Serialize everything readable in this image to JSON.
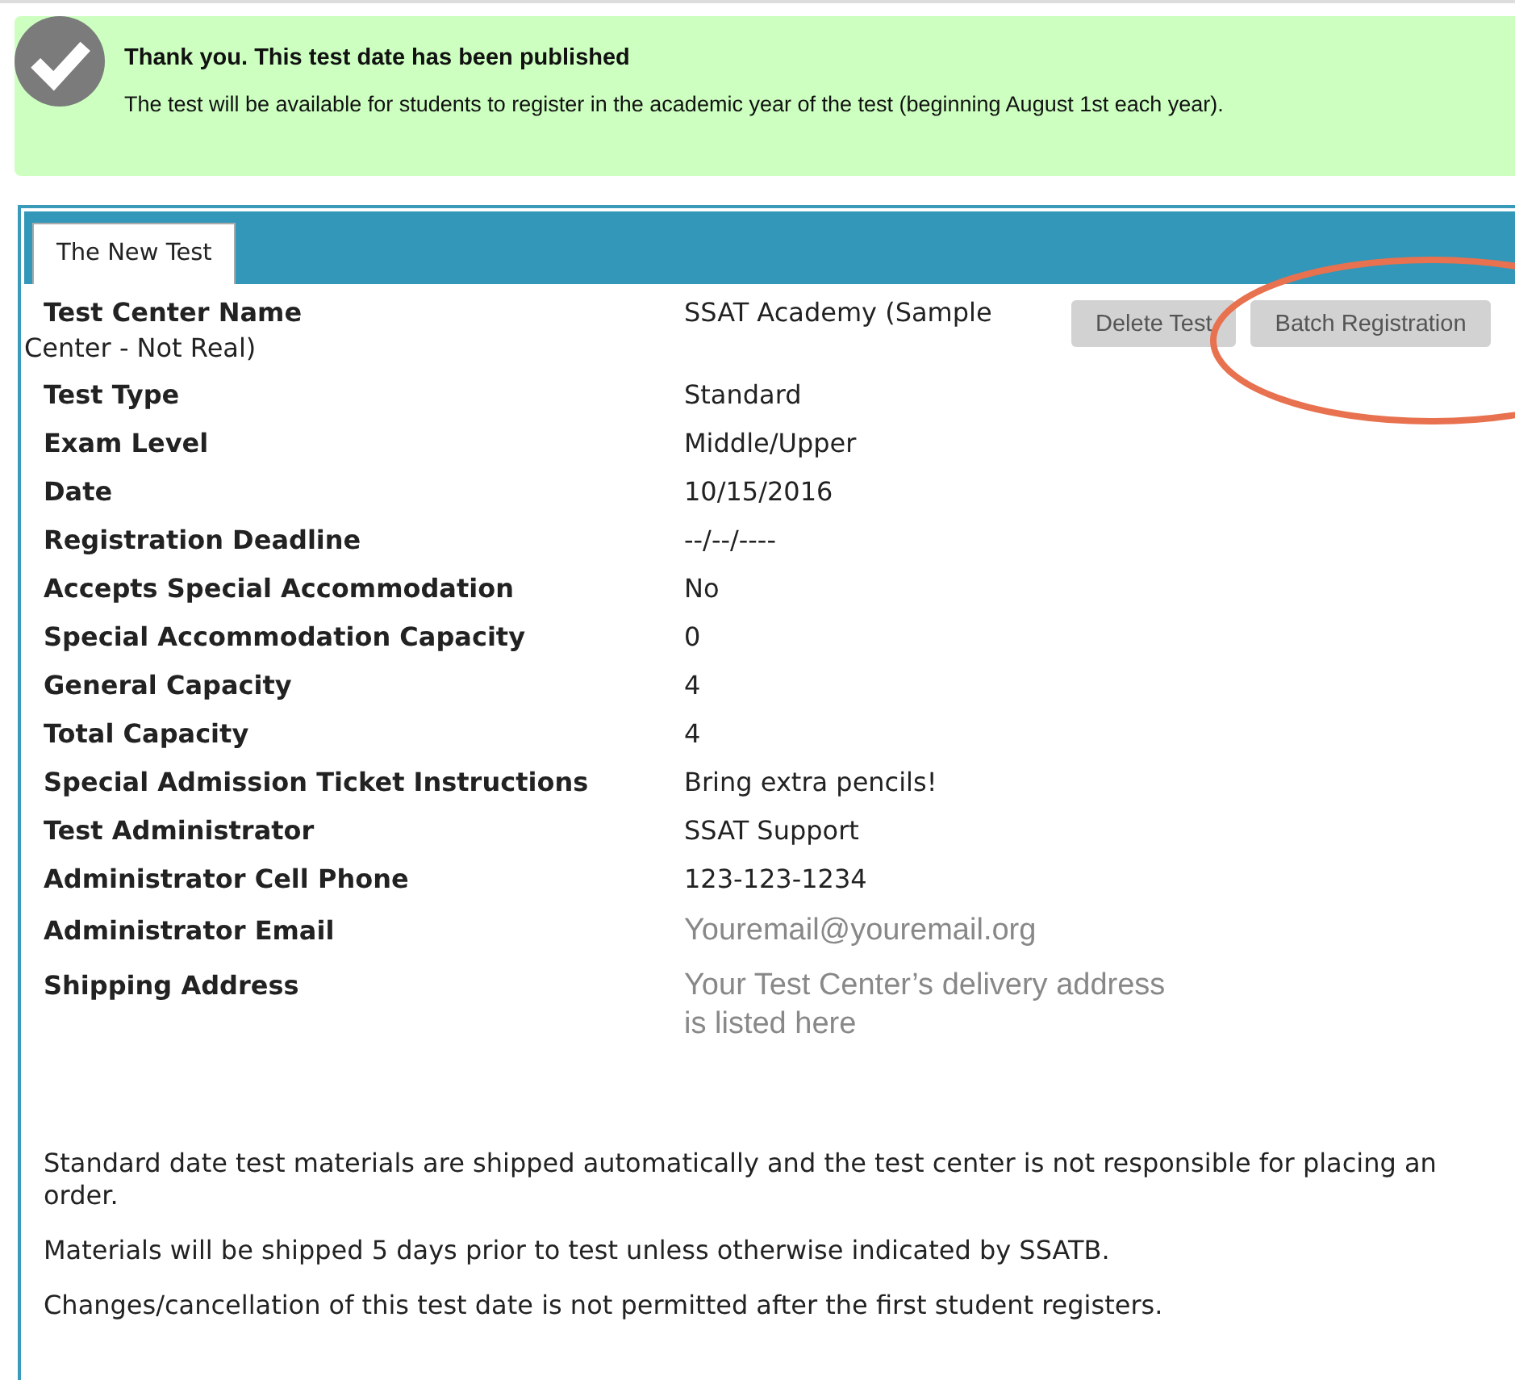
{
  "banner": {
    "title": "Thank you. This test date has been published",
    "message": "The test will be available for students to register in the academic year of the test (beginning August 1st each year)."
  },
  "tabs": [
    {
      "label": "The New Test",
      "selected": true
    }
  ],
  "buttons": [
    "Delete Test",
    "Batch Registration"
  ],
  "header_field": {
    "label": "Test Center Name",
    "value": "SSAT Academy (Sample",
    "value_overflow": "Center - Not Real)"
  },
  "fields": [
    {
      "label": "Test Type",
      "value": "Standard",
      "kind": "plain"
    },
    {
      "label": "Exam Level",
      "value": "Middle/Upper",
      "kind": "plain"
    },
    {
      "label": "Date",
      "value": "10/15/2016",
      "kind": "plain"
    },
    {
      "label": "Registration Deadline",
      "value": "--/--/----",
      "kind": "plain"
    },
    {
      "label": "Accepts Special Accommodation",
      "value": "No",
      "kind": "plain"
    },
    {
      "label": "Special Accommodation Capacity",
      "value": "0",
      "kind": "plain"
    },
    {
      "label": "General Capacity",
      "value": "4",
      "kind": "plain"
    },
    {
      "label": "Total Capacity",
      "value": "4",
      "kind": "plain"
    },
    {
      "label": "Special Admission Ticket Instructions",
      "value": "Bring extra pencils!",
      "kind": "plain"
    },
    {
      "label": "Test Administrator",
      "value": "SSAT Support",
      "kind": "plain"
    },
    {
      "label": "Administrator Cell Phone",
      "value": "123-123-1234",
      "kind": "plain"
    },
    {
      "label": "Administrator Email",
      "value": "Youremail@youremail.org",
      "kind": "note"
    },
    {
      "label": "Shipping Address",
      "value": "Your Test Center’s delivery address is listed here",
      "kind": "note"
    }
  ],
  "notes": [
    "Standard date test materials are shipped automatically and the test center is not responsible for placing an order.",
    "Materials will be shipped 5 days prior to test unless otherwise indicated by SSATB.",
    "Changes/cancellation of this test date is not permitted after the first student registers."
  ]
}
